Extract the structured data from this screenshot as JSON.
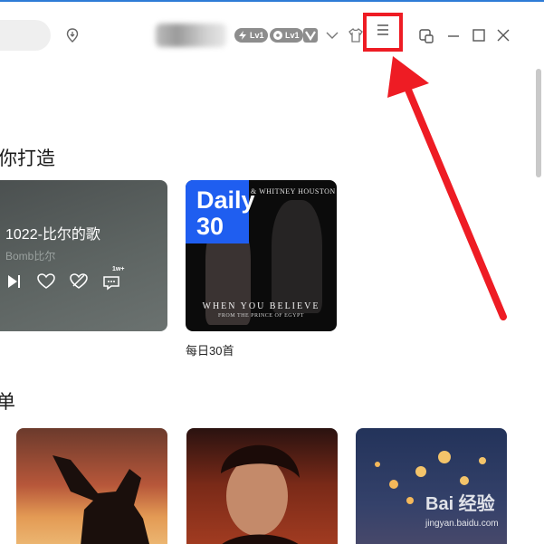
{
  "header": {
    "badges": [
      {
        "label": "Lv1",
        "icon": "lightning-icon"
      },
      {
        "label": "Lv1",
        "icon": "disc-icon"
      }
    ],
    "window_controls": [
      "mini-mode-icon",
      "minimize-icon",
      "maximize-icon",
      "close-icon"
    ]
  },
  "section_for_you": {
    "title": "你打造",
    "playlist_card": {
      "title": "1022-比尔的歌",
      "subtitle": "Bomb比尔",
      "comment_count": "1w+"
    },
    "daily_card": {
      "cover_word": "Daily",
      "cover_number": "30",
      "cover_artist": "& WHITNEY HOUSTON",
      "cover_song": "WHEN YOU BELIEVE",
      "cover_from": "FROM THE PRINCE OF EGYPT",
      "caption": "每日30首"
    }
  },
  "section_playlists": {
    "title": "单"
  },
  "watermark": {
    "brand": "Bai 经验",
    "url": "jingyan.baidu.com"
  },
  "colors": {
    "accent_line": "#2e7bd6",
    "highlight_box": "#ee1c24",
    "daily_blue": "#1f5ef0"
  }
}
